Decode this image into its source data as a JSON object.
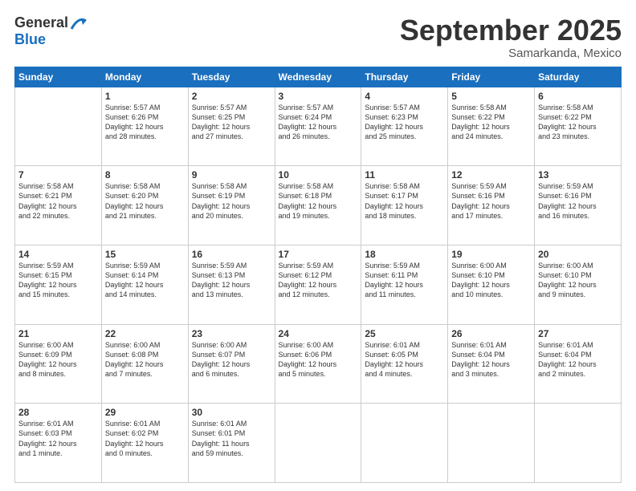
{
  "header": {
    "logo_general": "General",
    "logo_blue": "Blue",
    "month": "September 2025",
    "location": "Samarkanda, Mexico"
  },
  "weekdays": [
    "Sunday",
    "Monday",
    "Tuesday",
    "Wednesday",
    "Thursday",
    "Friday",
    "Saturday"
  ],
  "rows": [
    [
      {
        "day": "",
        "info": ""
      },
      {
        "day": "1",
        "info": "Sunrise: 5:57 AM\nSunset: 6:26 PM\nDaylight: 12 hours\nand 28 minutes."
      },
      {
        "day": "2",
        "info": "Sunrise: 5:57 AM\nSunset: 6:25 PM\nDaylight: 12 hours\nand 27 minutes."
      },
      {
        "day": "3",
        "info": "Sunrise: 5:57 AM\nSunset: 6:24 PM\nDaylight: 12 hours\nand 26 minutes."
      },
      {
        "day": "4",
        "info": "Sunrise: 5:57 AM\nSunset: 6:23 PM\nDaylight: 12 hours\nand 25 minutes."
      },
      {
        "day": "5",
        "info": "Sunrise: 5:58 AM\nSunset: 6:22 PM\nDaylight: 12 hours\nand 24 minutes."
      },
      {
        "day": "6",
        "info": "Sunrise: 5:58 AM\nSunset: 6:22 PM\nDaylight: 12 hours\nand 23 minutes."
      }
    ],
    [
      {
        "day": "7",
        "info": "Sunrise: 5:58 AM\nSunset: 6:21 PM\nDaylight: 12 hours\nand 22 minutes."
      },
      {
        "day": "8",
        "info": "Sunrise: 5:58 AM\nSunset: 6:20 PM\nDaylight: 12 hours\nand 21 minutes."
      },
      {
        "day": "9",
        "info": "Sunrise: 5:58 AM\nSunset: 6:19 PM\nDaylight: 12 hours\nand 20 minutes."
      },
      {
        "day": "10",
        "info": "Sunrise: 5:58 AM\nSunset: 6:18 PM\nDaylight: 12 hours\nand 19 minutes."
      },
      {
        "day": "11",
        "info": "Sunrise: 5:58 AM\nSunset: 6:17 PM\nDaylight: 12 hours\nand 18 minutes."
      },
      {
        "day": "12",
        "info": "Sunrise: 5:59 AM\nSunset: 6:16 PM\nDaylight: 12 hours\nand 17 minutes."
      },
      {
        "day": "13",
        "info": "Sunrise: 5:59 AM\nSunset: 6:16 PM\nDaylight: 12 hours\nand 16 minutes."
      }
    ],
    [
      {
        "day": "14",
        "info": "Sunrise: 5:59 AM\nSunset: 6:15 PM\nDaylight: 12 hours\nand 15 minutes."
      },
      {
        "day": "15",
        "info": "Sunrise: 5:59 AM\nSunset: 6:14 PM\nDaylight: 12 hours\nand 14 minutes."
      },
      {
        "day": "16",
        "info": "Sunrise: 5:59 AM\nSunset: 6:13 PM\nDaylight: 12 hours\nand 13 minutes."
      },
      {
        "day": "17",
        "info": "Sunrise: 5:59 AM\nSunset: 6:12 PM\nDaylight: 12 hours\nand 12 minutes."
      },
      {
        "day": "18",
        "info": "Sunrise: 5:59 AM\nSunset: 6:11 PM\nDaylight: 12 hours\nand 11 minutes."
      },
      {
        "day": "19",
        "info": "Sunrise: 6:00 AM\nSunset: 6:10 PM\nDaylight: 12 hours\nand 10 minutes."
      },
      {
        "day": "20",
        "info": "Sunrise: 6:00 AM\nSunset: 6:10 PM\nDaylight: 12 hours\nand 9 minutes."
      }
    ],
    [
      {
        "day": "21",
        "info": "Sunrise: 6:00 AM\nSunset: 6:09 PM\nDaylight: 12 hours\nand 8 minutes."
      },
      {
        "day": "22",
        "info": "Sunrise: 6:00 AM\nSunset: 6:08 PM\nDaylight: 12 hours\nand 7 minutes."
      },
      {
        "day": "23",
        "info": "Sunrise: 6:00 AM\nSunset: 6:07 PM\nDaylight: 12 hours\nand 6 minutes."
      },
      {
        "day": "24",
        "info": "Sunrise: 6:00 AM\nSunset: 6:06 PM\nDaylight: 12 hours\nand 5 minutes."
      },
      {
        "day": "25",
        "info": "Sunrise: 6:01 AM\nSunset: 6:05 PM\nDaylight: 12 hours\nand 4 minutes."
      },
      {
        "day": "26",
        "info": "Sunrise: 6:01 AM\nSunset: 6:04 PM\nDaylight: 12 hours\nand 3 minutes."
      },
      {
        "day": "27",
        "info": "Sunrise: 6:01 AM\nSunset: 6:04 PM\nDaylight: 12 hours\nand 2 minutes."
      }
    ],
    [
      {
        "day": "28",
        "info": "Sunrise: 6:01 AM\nSunset: 6:03 PM\nDaylight: 12 hours\nand 1 minute."
      },
      {
        "day": "29",
        "info": "Sunrise: 6:01 AM\nSunset: 6:02 PM\nDaylight: 12 hours\nand 0 minutes."
      },
      {
        "day": "30",
        "info": "Sunrise: 6:01 AM\nSunset: 6:01 PM\nDaylight: 11 hours\nand 59 minutes."
      },
      {
        "day": "",
        "info": ""
      },
      {
        "day": "",
        "info": ""
      },
      {
        "day": "",
        "info": ""
      },
      {
        "day": "",
        "info": ""
      }
    ]
  ]
}
